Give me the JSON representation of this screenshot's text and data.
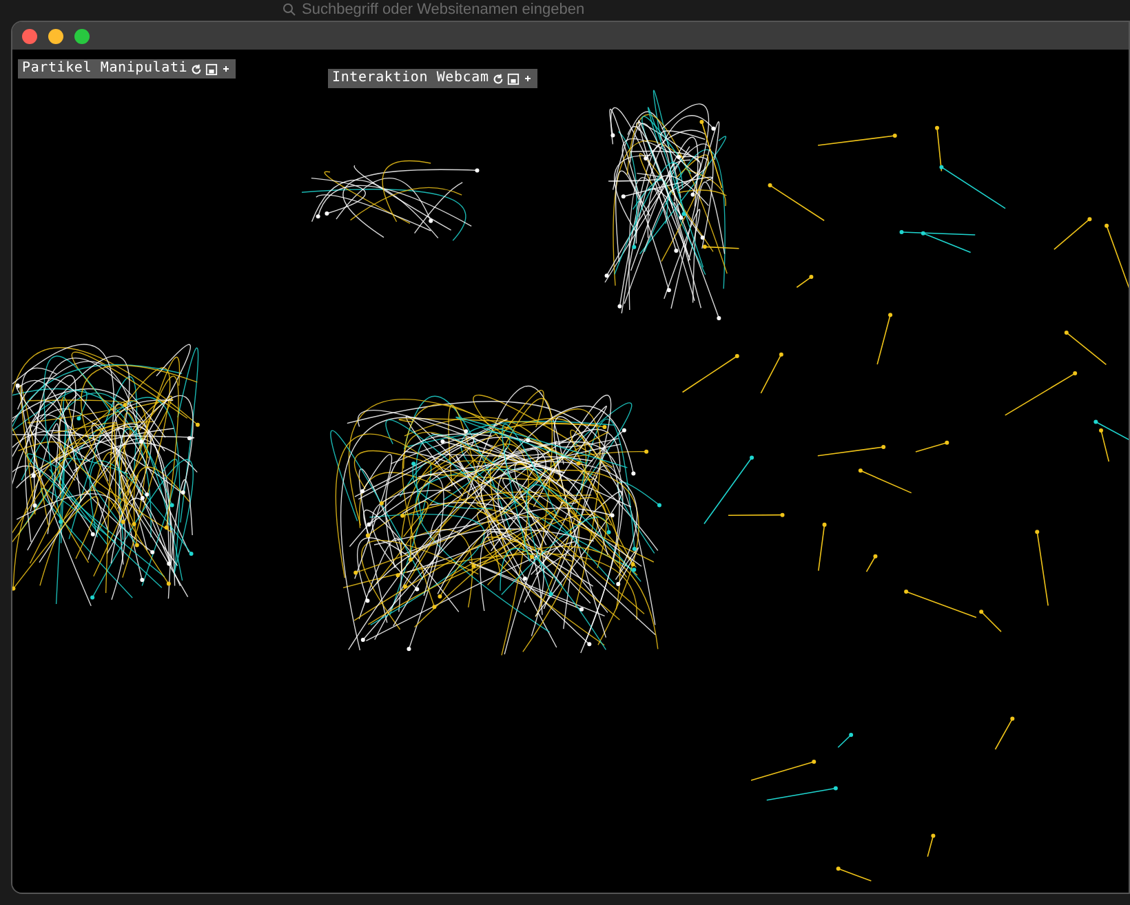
{
  "browser": {
    "search_placeholder": "Suchbegriff oder Websitenamen eingeben"
  },
  "panels": [
    {
      "title": "Partikel Manipulati"
    },
    {
      "title": "Interaktion Webcam"
    }
  ]
}
